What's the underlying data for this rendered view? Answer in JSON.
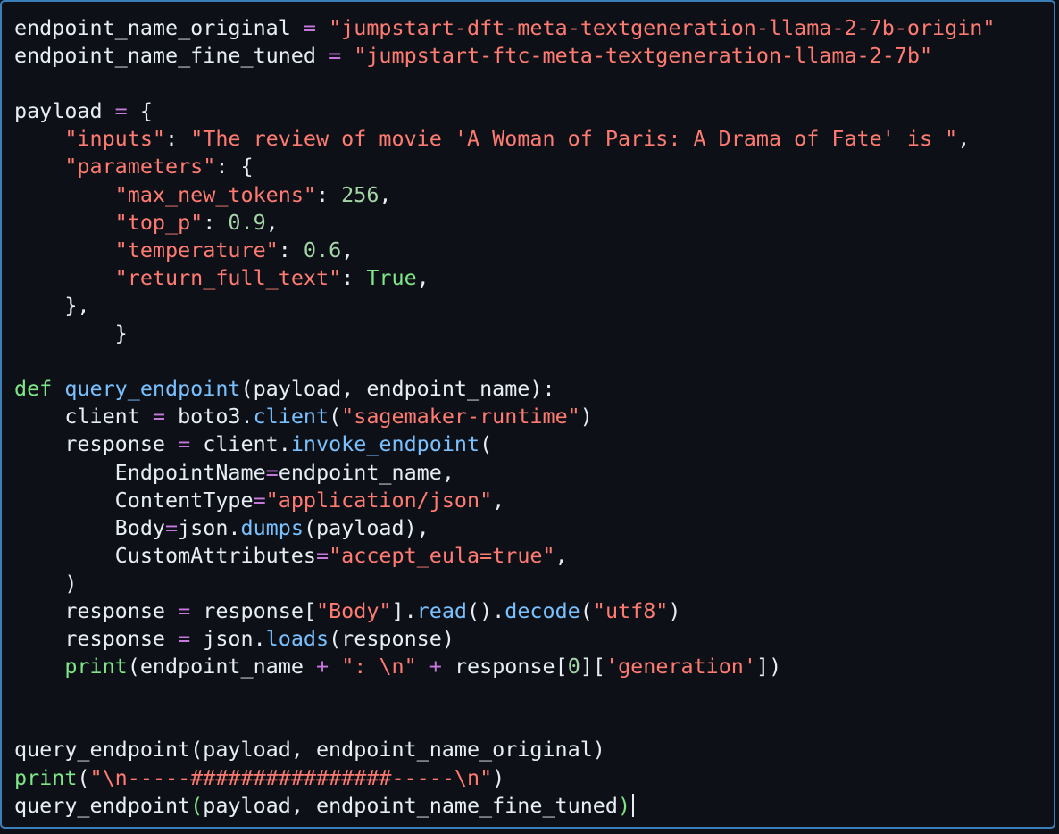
{
  "editor": {
    "lines": [
      [
        {
          "t": "endpoint_name_original ",
          "c": "p"
        },
        {
          "t": "=",
          "c": "k"
        },
        {
          "t": " ",
          "c": "p"
        },
        {
          "t": "\"jumpstart-dft-meta-textgeneration-llama-2-7b-origin\"",
          "c": "s"
        }
      ],
      [
        {
          "t": "endpoint_name_fine_tuned ",
          "c": "p"
        },
        {
          "t": "=",
          "c": "k"
        },
        {
          "t": " ",
          "c": "p"
        },
        {
          "t": "\"jumpstart-ftc-meta-textgeneration-llama-2-7b\"",
          "c": "s"
        }
      ],
      [],
      [
        {
          "t": "payload ",
          "c": "p"
        },
        {
          "t": "=",
          "c": "k"
        },
        {
          "t": " {",
          "c": "p"
        }
      ],
      [
        {
          "t": "    ",
          "c": "p"
        },
        {
          "t": "\"inputs\"",
          "c": "s"
        },
        {
          "t": ": ",
          "c": "p"
        },
        {
          "t": "\"The review of movie 'A Woman of Paris: A Drama of Fate' is \"",
          "c": "s"
        },
        {
          "t": ",",
          "c": "p"
        }
      ],
      [
        {
          "t": "    ",
          "c": "p"
        },
        {
          "t": "\"parameters\"",
          "c": "s"
        },
        {
          "t": ": {",
          "c": "p"
        }
      ],
      [
        {
          "t": "        ",
          "c": "p"
        },
        {
          "t": "\"max_new_tokens\"",
          "c": "s"
        },
        {
          "t": ": ",
          "c": "p"
        },
        {
          "t": "256",
          "c": "num"
        },
        {
          "t": ",",
          "c": "p"
        }
      ],
      [
        {
          "t": "        ",
          "c": "p"
        },
        {
          "t": "\"top_p\"",
          "c": "s"
        },
        {
          "t": ": ",
          "c": "p"
        },
        {
          "t": "0.9",
          "c": "num"
        },
        {
          "t": ",",
          "c": "p"
        }
      ],
      [
        {
          "t": "        ",
          "c": "p"
        },
        {
          "t": "\"temperature\"",
          "c": "s"
        },
        {
          "t": ": ",
          "c": "p"
        },
        {
          "t": "0.6",
          "c": "num"
        },
        {
          "t": ",",
          "c": "p"
        }
      ],
      [
        {
          "t": "        ",
          "c": "p"
        },
        {
          "t": "\"return_full_text\"",
          "c": "s"
        },
        {
          "t": ": ",
          "c": "p"
        },
        {
          "t": "True",
          "c": "d"
        },
        {
          "t": ",",
          "c": "p"
        }
      ],
      [
        {
          "t": "    },",
          "c": "p"
        }
      ],
      [
        {
          "t": "        }",
          "c": "p"
        }
      ],
      [],
      [
        {
          "t": "def",
          "c": "d"
        },
        {
          "t": " ",
          "c": "p"
        },
        {
          "t": "query_endpoint",
          "c": "n"
        },
        {
          "t": "(payload, endpoint_name):",
          "c": "p"
        }
      ],
      [
        {
          "t": "    client ",
          "c": "p"
        },
        {
          "t": "=",
          "c": "k"
        },
        {
          "t": " boto3.",
          "c": "p"
        },
        {
          "t": "client",
          "c": "n"
        },
        {
          "t": "(",
          "c": "p"
        },
        {
          "t": "\"sagemaker-runtime\"",
          "c": "s"
        },
        {
          "t": ")",
          "c": "p"
        }
      ],
      [
        {
          "t": "    response ",
          "c": "p"
        },
        {
          "t": "=",
          "c": "k"
        },
        {
          "t": " client.",
          "c": "p"
        },
        {
          "t": "invoke_endpoint",
          "c": "n"
        },
        {
          "t": "(",
          "c": "p"
        }
      ],
      [
        {
          "t": "        EndpointName",
          "c": "p"
        },
        {
          "t": "=",
          "c": "k"
        },
        {
          "t": "endpoint_name,",
          "c": "p"
        }
      ],
      [
        {
          "t": "        ContentType",
          "c": "p"
        },
        {
          "t": "=",
          "c": "k"
        },
        {
          "t": "\"application/json\"",
          "c": "s"
        },
        {
          "t": ",",
          "c": "p"
        }
      ],
      [
        {
          "t": "        Body",
          "c": "p"
        },
        {
          "t": "=",
          "c": "k"
        },
        {
          "t": "json.",
          "c": "p"
        },
        {
          "t": "dumps",
          "c": "n"
        },
        {
          "t": "(payload),",
          "c": "p"
        }
      ],
      [
        {
          "t": "        CustomAttributes",
          "c": "p"
        },
        {
          "t": "=",
          "c": "k"
        },
        {
          "t": "\"accept_eula=true\"",
          "c": "s"
        },
        {
          "t": ",",
          "c": "p"
        }
      ],
      [
        {
          "t": "    )",
          "c": "p"
        }
      ],
      [
        {
          "t": "    response ",
          "c": "p"
        },
        {
          "t": "=",
          "c": "k"
        },
        {
          "t": " response[",
          "c": "p"
        },
        {
          "t": "\"Body\"",
          "c": "s"
        },
        {
          "t": "].",
          "c": "p"
        },
        {
          "t": "read",
          "c": "n"
        },
        {
          "t": "().",
          "c": "p"
        },
        {
          "t": "decode",
          "c": "n"
        },
        {
          "t": "(",
          "c": "p"
        },
        {
          "t": "\"utf8\"",
          "c": "s"
        },
        {
          "t": ")",
          "c": "p"
        }
      ],
      [
        {
          "t": "    response ",
          "c": "p"
        },
        {
          "t": "=",
          "c": "k"
        },
        {
          "t": " json.",
          "c": "p"
        },
        {
          "t": "loads",
          "c": "n"
        },
        {
          "t": "(response)",
          "c": "p"
        }
      ],
      [
        {
          "t": "    ",
          "c": "p"
        },
        {
          "t": "print",
          "c": "b"
        },
        {
          "t": "(endpoint_name ",
          "c": "p"
        },
        {
          "t": "+",
          "c": "k"
        },
        {
          "t": " ",
          "c": "p"
        },
        {
          "t": "\": \\n\"",
          "c": "s"
        },
        {
          "t": " ",
          "c": "p"
        },
        {
          "t": "+",
          "c": "k"
        },
        {
          "t": " response[",
          "c": "p"
        },
        {
          "t": "0",
          "c": "num"
        },
        {
          "t": "][",
          "c": "p"
        },
        {
          "t": "'generation'",
          "c": "s"
        },
        {
          "t": "])",
          "c": "p"
        }
      ],
      [],
      [],
      [
        {
          "t": "query_endpoint(payload, endpoint_name_original)",
          "c": "p"
        }
      ],
      [
        {
          "t": "print",
          "c": "b"
        },
        {
          "t": "(",
          "c": "p"
        },
        {
          "t": "\"\\n-----################-----\\n\"",
          "c": "s"
        },
        {
          "t": ")",
          "c": "p"
        }
      ],
      [
        {
          "t": "query_endpoint",
          "c": "p"
        },
        {
          "t": "(",
          "c": "b"
        },
        {
          "t": "payload, endpoint_name_fine_tuned",
          "c": "p"
        },
        {
          "t": ")",
          "c": "b"
        },
        {
          "cursor": true
        }
      ]
    ]
  }
}
